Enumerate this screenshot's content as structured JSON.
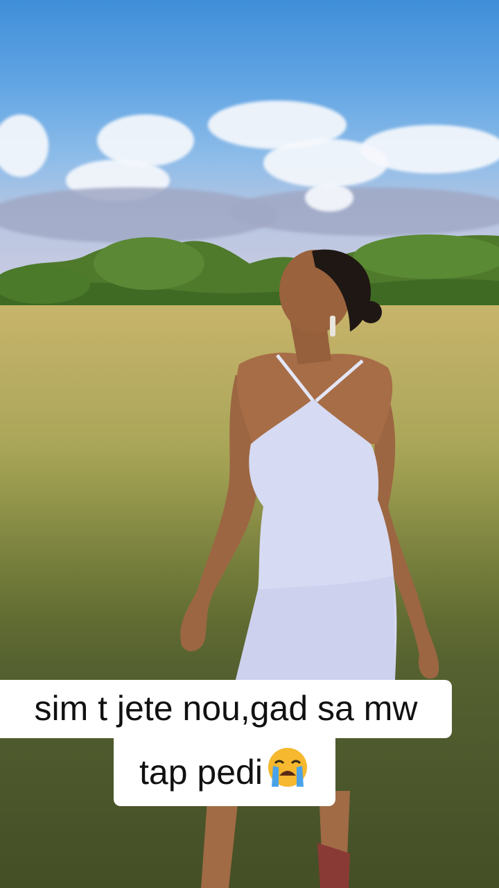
{
  "caption": {
    "line1": "sim t jete nou,gad sa mw",
    "line2": "tap pedi"
  },
  "caption_emoji": "loudly-crying-face-icon",
  "colors": {
    "caption_bg": "#ffffff",
    "caption_text": "#111111",
    "dress": "#d6daf3",
    "sky": "#4f9ae0",
    "grass": "#8f9a48"
  }
}
